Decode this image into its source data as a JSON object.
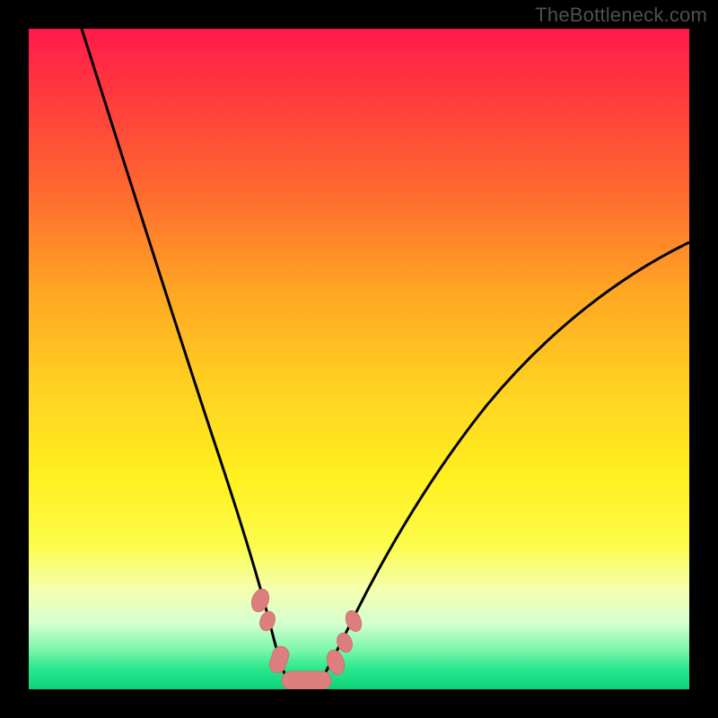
{
  "watermark": "TheBottleneck.com",
  "chart_data": {
    "type": "line",
    "title": "",
    "xlabel": "",
    "ylabel": "",
    "xlim": [
      0,
      100
    ],
    "ylim": [
      0,
      100
    ],
    "background_gradient": {
      "top": "#ff1a4a",
      "mid": "#fff020",
      "bottom": "#0fd27a",
      "meaning": "bottleneck severity (red=high, green=low)"
    },
    "series": [
      {
        "name": "left-curve",
        "x": [
          8,
          12,
          16,
          20,
          24,
          28,
          30,
          32,
          34,
          35,
          36
        ],
        "y": [
          100,
          84,
          67,
          50,
          34,
          19,
          12,
          7,
          3,
          1,
          0
        ]
      },
      {
        "name": "right-curve",
        "x": [
          40,
          42,
          44,
          48,
          55,
          65,
          75,
          85,
          95,
          100
        ],
        "y": [
          0,
          2,
          5,
          12,
          22,
          35,
          46,
          55,
          63,
          67
        ]
      },
      {
        "name": "bottom-markers",
        "type": "scatter",
        "x": [
          30,
          32,
          34,
          36,
          38,
          40,
          42,
          44
        ],
        "y": [
          10,
          4,
          1,
          0,
          0,
          1,
          4,
          8
        ],
        "color": "#e08080"
      }
    ]
  }
}
